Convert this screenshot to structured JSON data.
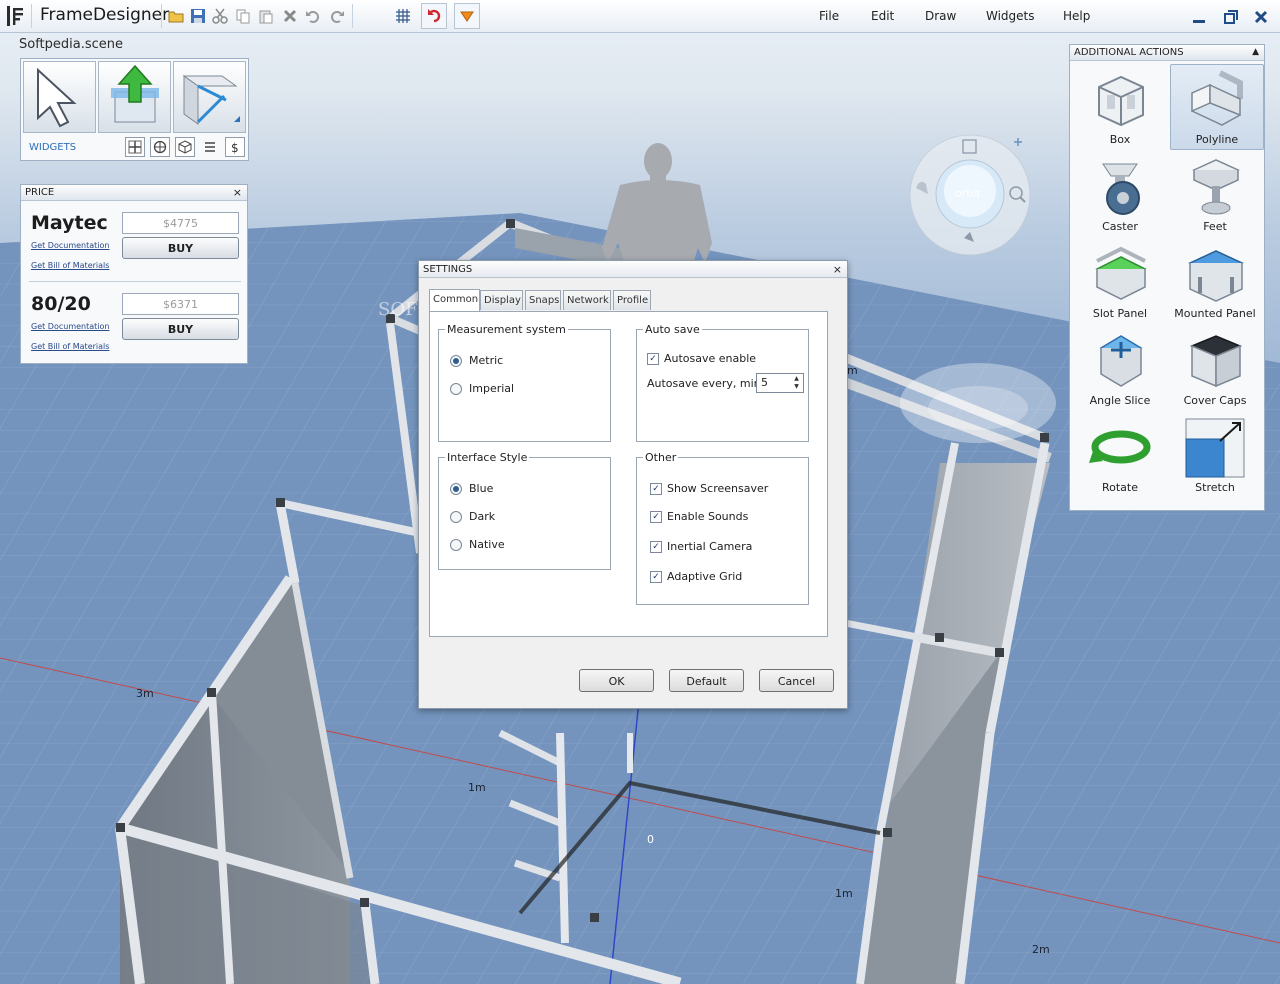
{
  "app": {
    "title": "FrameDesigner",
    "scene_name": "Softpedia.scene"
  },
  "menu": {
    "items": [
      "File",
      "Edit",
      "Draw",
      "Widgets",
      "Help"
    ]
  },
  "widgets_panel": {
    "label": "WIDGETS"
  },
  "price_panel": {
    "title": "PRICE",
    "close": "×",
    "vendors": [
      {
        "name": "Maytec",
        "price": "$4775",
        "doc_link": "Get Documentation",
        "bom_link": "Get Bill of Materials",
        "buy_label": "BUY"
      },
      {
        "name": "80/20",
        "price": "$6371",
        "doc_link": "Get Documentation",
        "bom_link": "Get Bill of Materials",
        "buy_label": "BUY"
      }
    ]
  },
  "settings": {
    "title": "SETTINGS",
    "close": "×",
    "tabs": [
      "Common",
      "Display",
      "Snaps",
      "Network",
      "Profile"
    ],
    "active_tab": "Common",
    "measurement": {
      "title": "Measurement  system",
      "options": [
        "Metric",
        "Imperial"
      ],
      "selected": "Metric"
    },
    "autosave": {
      "title": "Auto save",
      "enable_label": "Autosave enable",
      "enabled": true,
      "every_label": "Autosave every, min",
      "every_value": "5"
    },
    "interface_style": {
      "title": "Interface Style",
      "options": [
        "Blue",
        "Dark",
        "Native"
      ],
      "selected": "Blue"
    },
    "other": {
      "title": "Other",
      "options": [
        {
          "label": "Show Screensaver",
          "checked": true
        },
        {
          "label": "Enable Sounds",
          "checked": true
        },
        {
          "label": "Inertial Camera",
          "checked": true
        },
        {
          "label": "Adaptive Grid",
          "checked": true
        }
      ]
    },
    "buttons": {
      "ok": "OK",
      "default": "Default",
      "cancel": "Cancel"
    }
  },
  "actions_panel": {
    "title": "ADDITIONAL ACTIONS",
    "items": [
      "Box",
      "Polyline",
      "Caster",
      "Feet",
      "Slot Panel",
      "Mounted Panel",
      "Angle Slice",
      "Cover Caps",
      "Rotate",
      "Stretch"
    ],
    "selected": "Polyline"
  },
  "viewport": {
    "grid_labels": [
      "3m",
      "1m",
      "0",
      "1m",
      "2m",
      "m"
    ],
    "watermark": "SOFTPEDIA",
    "orbit_label": "orbit"
  },
  "colors": {
    "accent": "#2d6fb8",
    "grid_line": "#8aa6c8",
    "frame": "#d8dde3",
    "panel": "#7d8590"
  }
}
